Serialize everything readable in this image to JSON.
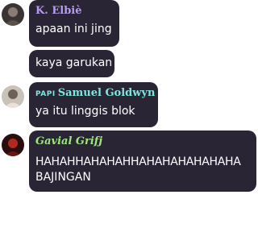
{
  "colors": {
    "bubble_bg": "#2a2535",
    "message_text": "#ffffff",
    "sender_elbie": "#b79cf0",
    "sender_samuel": "#7fe6df",
    "sender_gavial": "#9fe67f"
  },
  "messages": [
    {
      "sender": "K. Elbiè",
      "text": "apaan ini jing"
    },
    {
      "sender": "",
      "text": "kaya garukan"
    },
    {
      "sender_tag": "PAPI",
      "sender": "Samuel Goldwyn",
      "text": "ya itu linggis blok"
    },
    {
      "sender": "Gavial Grifj",
      "text_line1": "HAHAHHAHAHAHHAHAHAHAHAHAHA",
      "text_line2": "BAJINGAN"
    }
  ]
}
